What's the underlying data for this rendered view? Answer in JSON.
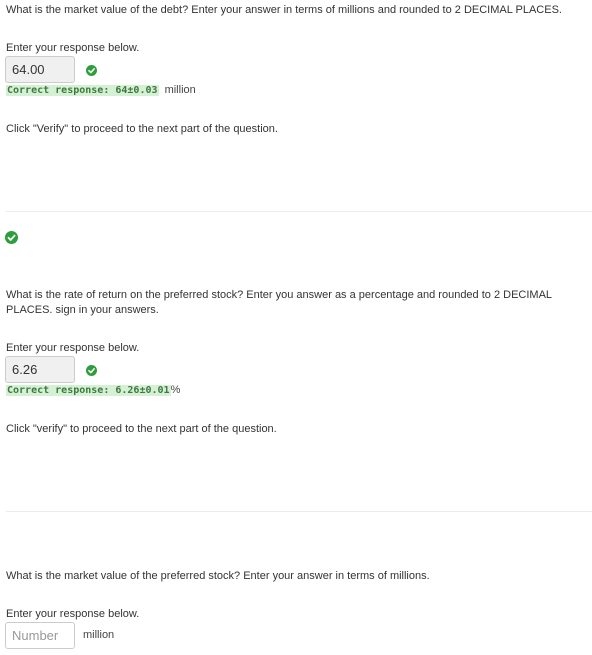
{
  "part1": {
    "question": "What is the market value of the debt? Enter your answer in terms of millions and rounded to 2 DECIMAL PLACES.",
    "prompt": "Enter your response below.",
    "answer_value": "64.00",
    "correct_label": "Correct response: 64±0.03",
    "unit": "million",
    "instruction": "Click \"Verify\" to proceed to the next part of the question."
  },
  "part2": {
    "question": "What is the rate of return on the preferred stock? Enter you answer as a percentage and rounded to 2 DECIMAL PLACES. sign in your answers.",
    "prompt": "Enter your response below.",
    "answer_value": "6.26",
    "correct_label": "Correct response: 6.26±0.01",
    "unit": "%",
    "instruction": "Click \"verify\" to proceed to the next part of the question."
  },
  "part3": {
    "question": "What is the market value of the preferred stock? Enter your answer in terms of millions.",
    "prompt": "Enter your response below.",
    "placeholder": "Number",
    "unit": "million"
  },
  "colors": {
    "check_green": "#2e9e3c",
    "correct_bg": "#d6f0d6",
    "correct_text": "#3c7a3c"
  },
  "icons": {
    "status": "check-circle-icon"
  }
}
